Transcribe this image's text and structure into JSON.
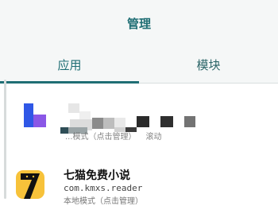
{
  "header": {
    "title": "管理"
  },
  "tabs": [
    {
      "label": "应用"
    },
    {
      "label": "模块"
    }
  ],
  "apps": [
    {
      "mode_text": "...模式（点击管理）",
      "extra": "滚动"
    },
    {
      "name": "七猫免费小说",
      "package": "com.kmxs.reader",
      "mode_text": "本地模式（点击管理）"
    }
  ],
  "colors": {
    "accent": "#1f6e74",
    "icon_yellow": "#f7c23a"
  }
}
